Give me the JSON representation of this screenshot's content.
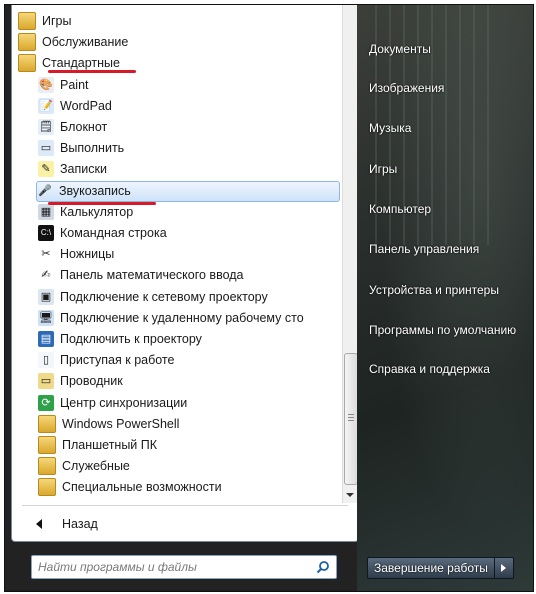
{
  "programs": {
    "items": [
      {
        "label": "Игры",
        "type": "folder",
        "icon": "folder-icon"
      },
      {
        "label": "Обслуживание",
        "type": "folder",
        "icon": "folder-icon"
      },
      {
        "label": "Стандартные",
        "type": "folder",
        "icon": "folder-icon"
      },
      {
        "label": "Paint",
        "type": "sub",
        "icon": "paint-icon"
      },
      {
        "label": "WordPad",
        "type": "sub",
        "icon": "wordpad-icon"
      },
      {
        "label": "Блокнот",
        "type": "sub",
        "icon": "notepad-icon"
      },
      {
        "label": "Выполнить",
        "type": "sub",
        "icon": "run-icon"
      },
      {
        "label": "Записки",
        "type": "sub",
        "icon": "sticky-notes-icon"
      },
      {
        "label": "Звукозапись",
        "type": "sub",
        "icon": "microphone-icon",
        "selected": true
      },
      {
        "label": "Калькулятор",
        "type": "sub",
        "icon": "calculator-icon"
      },
      {
        "label": "Командная строка",
        "type": "sub",
        "icon": "command-prompt-icon"
      },
      {
        "label": "Ножницы",
        "type": "sub",
        "icon": "scissors-icon"
      },
      {
        "label": "Панель математического ввода",
        "type": "sub",
        "icon": "math-input-icon"
      },
      {
        "label": "Подключение к сетевому проектору",
        "type": "sub",
        "icon": "network-projector-icon"
      },
      {
        "label": "Подключение к удаленному рабочему сто",
        "type": "sub",
        "icon": "remote-desktop-icon"
      },
      {
        "label": "Подключить к проектору",
        "type": "sub",
        "icon": "projector-icon"
      },
      {
        "label": "Приступая к работе",
        "type": "sub",
        "icon": "getting-started-icon"
      },
      {
        "label": "Проводник",
        "type": "sub",
        "icon": "explorer-icon"
      },
      {
        "label": "Центр синхронизации",
        "type": "sub",
        "icon": "sync-center-icon"
      },
      {
        "label": "Windows PowerShell",
        "type": "sub-folder",
        "icon": "folder-icon"
      },
      {
        "label": "Планшетный ПК",
        "type": "sub-folder",
        "icon": "folder-icon"
      },
      {
        "label": "Служебные",
        "type": "sub-folder",
        "icon": "folder-icon"
      },
      {
        "label": "Специальные возможности",
        "type": "sub-folder",
        "icon": "folder-icon"
      }
    ],
    "back_label": "Назад"
  },
  "search": {
    "placeholder": "Найти программы и файлы",
    "icon": "search-icon"
  },
  "right_panel": {
    "items": [
      "Документы",
      "Изображения",
      "Музыка",
      "Игры",
      "Компьютер",
      "Панель управления",
      "Устройства и принтеры",
      "Программы по умолчанию",
      "Справка и поддержка"
    ],
    "shutdown_label": "Завершение работы"
  },
  "colors": {
    "highlight_underline": "#d61a2a",
    "selection_border": "#8fb7e6"
  }
}
